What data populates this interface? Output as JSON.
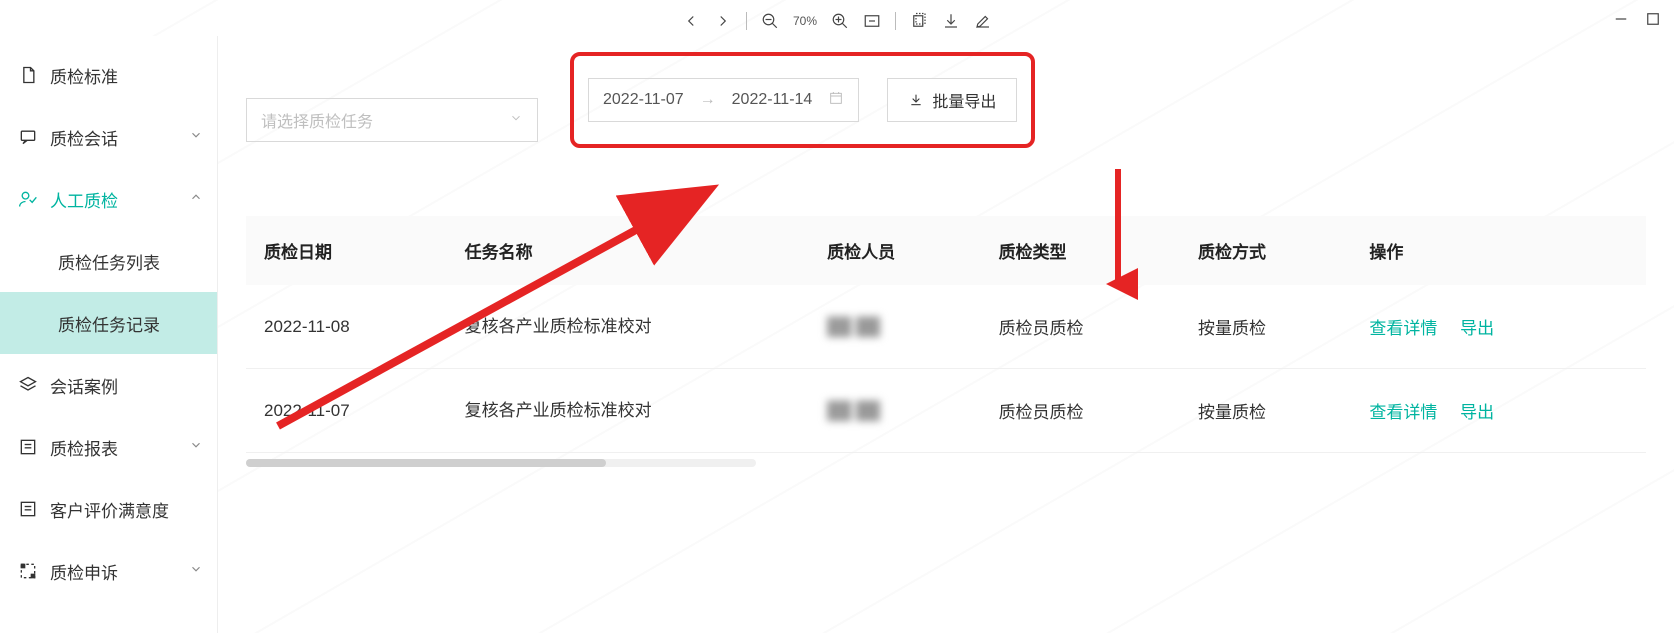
{
  "toolbar": {
    "zoom_pct": "70%"
  },
  "sidebar": {
    "items": [
      {
        "label": "质检标准",
        "icon": "file"
      },
      {
        "label": "质检会话",
        "icon": "chat",
        "expandable": true
      },
      {
        "label": "人工质检",
        "icon": "person",
        "active": true,
        "expanded": true
      },
      {
        "label": "质检任务列表",
        "sub": true
      },
      {
        "label": "质检任务记录",
        "sub": true,
        "selected": true
      },
      {
        "label": "会话案例",
        "icon": "stack"
      },
      {
        "label": "质检报表",
        "icon": "list"
      },
      {
        "label": "客户评价满意度",
        "icon": "list"
      },
      {
        "label": "质检申诉",
        "icon": "bounds"
      }
    ]
  },
  "filters": {
    "task_select_placeholder": "请选择质检任务",
    "date_start": "2022-11-07",
    "date_end": "2022-11-14",
    "export_label": "批量导出"
  },
  "table": {
    "headers": {
      "date": "质检日期",
      "task": "任务名称",
      "person": "质检人员",
      "type": "质检类型",
      "method": "质检方式",
      "ops": "操作"
    },
    "rows": [
      {
        "date": "2022-11-08",
        "task": "复核各产业质检标准校对",
        "person": "██ ██",
        "type": "质检员质检",
        "method": "按量质检"
      },
      {
        "date": "2022-11-07",
        "task": "复核各产业质检标准校对",
        "person": "██ ██",
        "type": "质检员质检",
        "method": "按量质检"
      }
    ],
    "action_detail": "查看详情",
    "action_export": "导出"
  }
}
